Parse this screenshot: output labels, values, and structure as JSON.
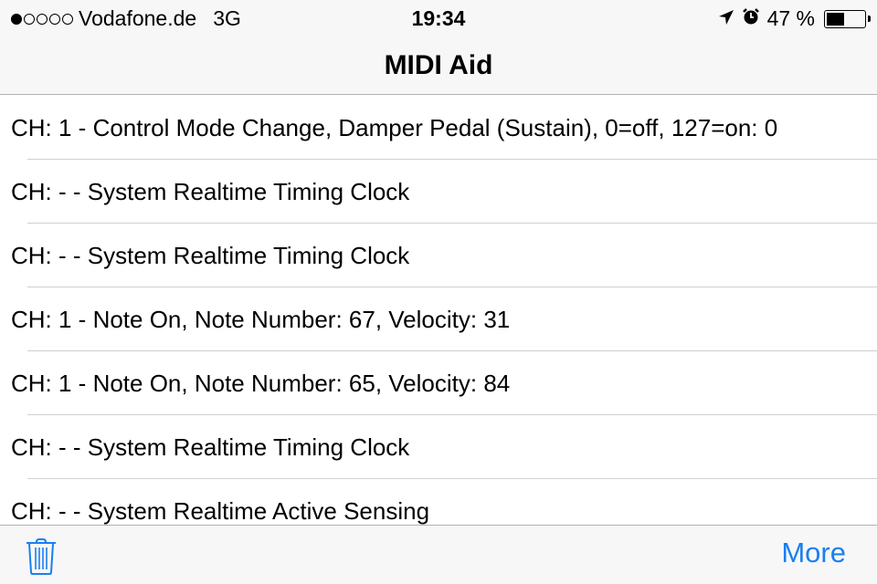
{
  "status_bar": {
    "signal_strength": "1 of 5",
    "carrier": "Vodafone.de",
    "network": "3G",
    "time": "19:34",
    "battery_text": "47 %",
    "battery_level": 0.47,
    "icons": [
      "location-arrow-icon",
      "alarm-clock-icon",
      "battery-icon"
    ]
  },
  "nav": {
    "title": "MIDI Aid"
  },
  "messages": [
    {
      "text": "CH: 1 - Control Mode Change, Damper Pedal (Sustain), 0=off, 127=on: 0"
    },
    {
      "text": "CH: - - System Realtime Timing Clock"
    },
    {
      "text": "CH: - - System Realtime Timing Clock"
    },
    {
      "text": "CH: 1 - Note On, Note Number: 67, Velocity: 31"
    },
    {
      "text": "CH: 1 - Note On, Note Number: 65, Velocity: 84"
    },
    {
      "text": "CH: - - System Realtime Timing Clock"
    },
    {
      "text": "CH: - - System Realtime Active Sensing"
    }
  ],
  "toolbar": {
    "trash_icon": "trash-icon",
    "more_label": "More",
    "accent_color": "#1a7ff0"
  }
}
